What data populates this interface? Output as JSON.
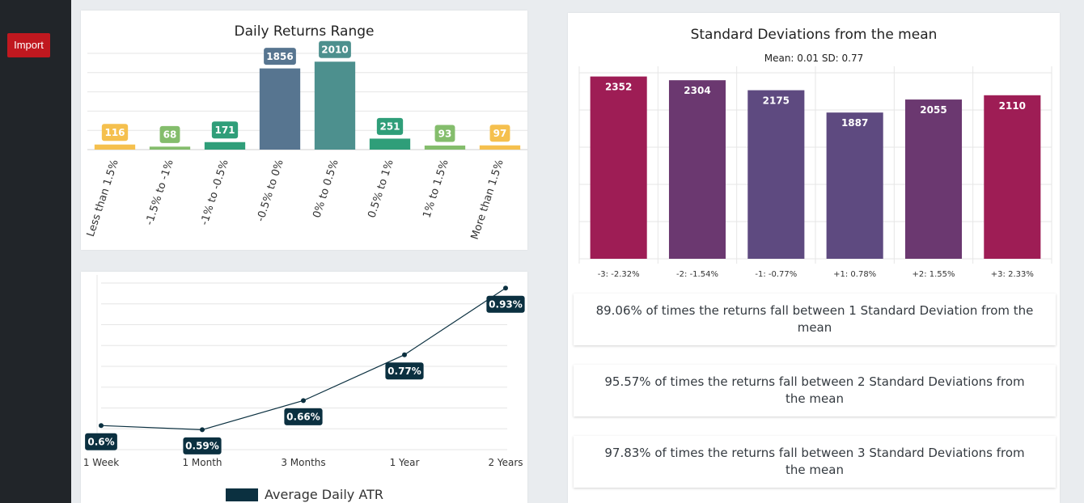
{
  "sidebar": {
    "import_label": "Import"
  },
  "colors": {
    "yellow": "#f5c04e",
    "light_green": "#84bd6c",
    "green": "#2f9e79",
    "slate": "#577590",
    "teal": "#4d908e",
    "navy": "#0b3040",
    "crimson": "#9e1d55",
    "purple": "#5e4a80",
    "plum": "#6b3870"
  },
  "returns_chart": {
    "chart_data": {
      "type": "bar",
      "title": "Daily Returns Range",
      "categories": [
        "Less than 1.5%",
        "-1.5% to -1%",
        "-1% to -0.5%",
        "-0.5% to 0%",
        "0% to 0.5%",
        "0.5% to 1%",
        "1% to 1.5%",
        "More than 1.5%"
      ],
      "values": [
        116,
        68,
        171,
        1856,
        2010,
        251,
        93,
        97
      ],
      "bar_colors": [
        "#f5c04e",
        "#84bd6c",
        "#2f9e79",
        "#577590",
        "#4d908e",
        "#2f9e79",
        "#84bd6c",
        "#f5c04e"
      ],
      "ylim": [
        0,
        2200
      ]
    }
  },
  "atr_chart": {
    "chart_data": {
      "type": "line",
      "categories": [
        "1 Week",
        "1 Month",
        "3 Months",
        "1 Year",
        "2 Years"
      ],
      "series": [
        {
          "name": "Average Daily ATR",
          "values": [
            0.6,
            0.59,
            0.66,
            0.77,
            0.93
          ],
          "labels": [
            "0.6%",
            "0.59%",
            "0.66%",
            "0.77%",
            "0.93%"
          ]
        }
      ],
      "ylim": [
        0.55,
        0.95
      ]
    }
  },
  "std_chart": {
    "chart_data": {
      "type": "bar",
      "title": "Standard Deviations from the mean",
      "subtitle": "Mean: 0.01  SD: 0.77",
      "categories": [
        "-3: -2.32%",
        "-2: -1.54%",
        "-1: -0.77%",
        "+1: 0.78%",
        "+2: 1.55%",
        "+3: 2.33%"
      ],
      "values": [
        2352,
        2304,
        2175,
        1887,
        2055,
        2110
      ],
      "bar_colors": [
        "#9e1d55",
        "#6b3870",
        "#5e4a80",
        "#5e4a80",
        "#6b3870",
        "#9e1d55"
      ],
      "ylim": [
        0,
        2400
      ]
    }
  },
  "stats": [
    "89.06% of times the returns fall between 1 Standard Deviation from the mean",
    "95.57% of times the returns fall between 2 Standard Deviations from the mean",
    "97.83% of times the returns fall between 3 Standard Deviations from the mean"
  ]
}
